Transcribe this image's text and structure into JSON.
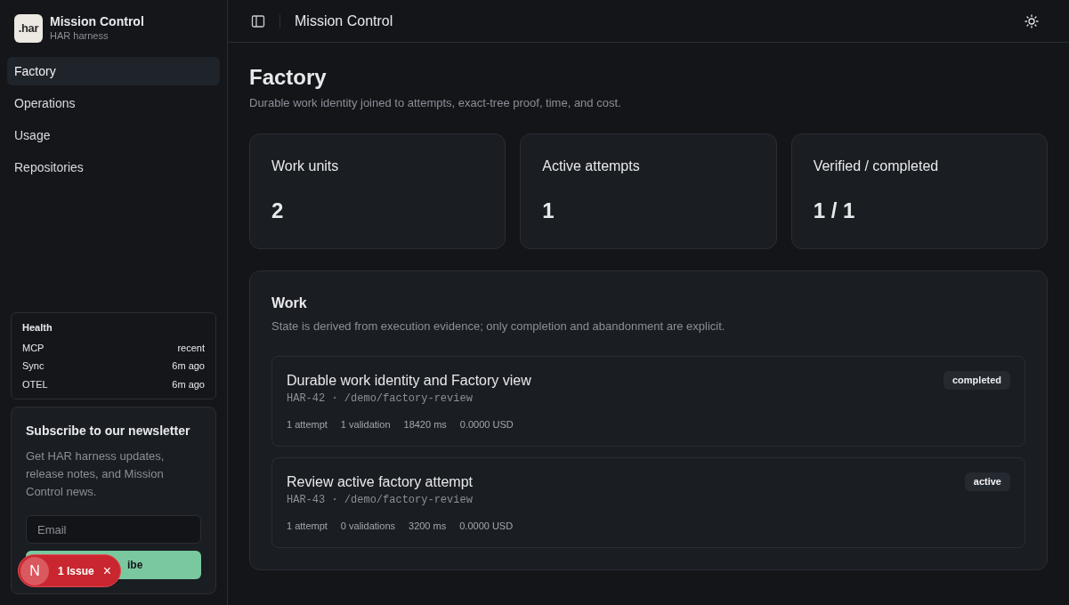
{
  "brand": {
    "logo": ".har",
    "title": "Mission Control",
    "subtitle": "HAR harness"
  },
  "nav": [
    {
      "label": "Factory",
      "selected": true
    },
    {
      "label": "Operations",
      "selected": false
    },
    {
      "label": "Usage",
      "selected": false
    },
    {
      "label": "Repositories",
      "selected": false
    }
  ],
  "health": {
    "title": "Health",
    "rows": [
      {
        "name": "MCP",
        "value": "recent"
      },
      {
        "name": "Sync",
        "value": "6m ago"
      },
      {
        "name": "OTEL",
        "value": "6m ago"
      }
    ]
  },
  "newsletter": {
    "title": "Subscribe to our newsletter",
    "text": "Get HAR harness updates, release notes, and Mission Control news.",
    "placeholder": "Email",
    "button": "ibe"
  },
  "issue_badge": {
    "letter": "N",
    "label": "1 Issue",
    "close": "×"
  },
  "header": {
    "title": "Mission Control"
  },
  "page": {
    "title": "Factory",
    "subtitle": "Durable work identity joined to attempts, exact-tree proof, time, and cost."
  },
  "stats": [
    {
      "label": "Work units",
      "value": "2"
    },
    {
      "label": "Active attempts",
      "value": "1"
    },
    {
      "label": "Verified / completed",
      "value": "1 / 1"
    }
  ],
  "work": {
    "separator": "·",
    "title": "Work",
    "subtitle": "State is derived from execution evidence; only completion and abandonment are explicit.",
    "items": [
      {
        "title": "Durable work identity and Factory view",
        "id": "HAR-42",
        "path": "/demo/factory-review",
        "status": "completed",
        "meta": [
          "1 attempt",
          "1 validation",
          "18420 ms",
          "0.0000 USD"
        ]
      },
      {
        "title": "Review active factory attempt",
        "id": "HAR-43",
        "path": "/demo/factory-review",
        "status": "active",
        "meta": [
          "1 attempt",
          "0 validations",
          "3200 ms",
          "0.0000 USD"
        ]
      }
    ]
  }
}
